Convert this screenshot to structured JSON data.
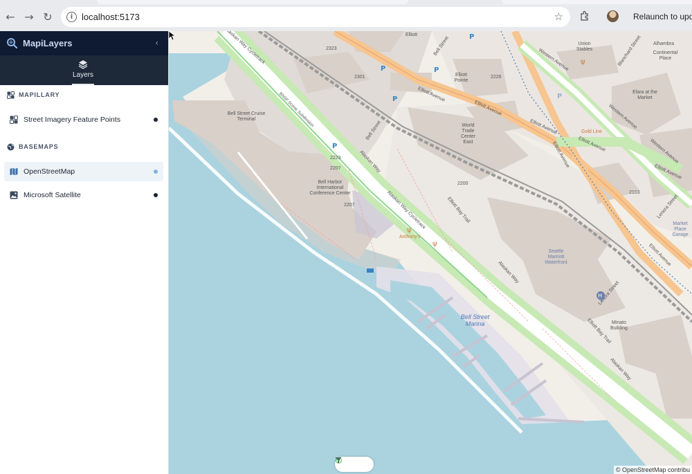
{
  "browser": {
    "url": "localhost:5173",
    "relaunch_label": "Relaunch to update"
  },
  "sidebar": {
    "app_name": "MapiLayers",
    "tabs": [
      {
        "label": "Layers",
        "icon": "layers-icon",
        "active": true
      }
    ],
    "sections": [
      {
        "title": "MAPILLARY",
        "icon": "mapillary-icon",
        "layers": [
          {
            "label": "Street Imagery Feature Points",
            "icon": "feature-points-icon",
            "active": false
          }
        ]
      },
      {
        "title": "BASEMAPS",
        "icon": "globe-icon",
        "layers": [
          {
            "label": "OpenStreetMap",
            "icon": "map-icon",
            "active": true
          },
          {
            "label": "Microsoft Satellite",
            "icon": "satellite-image-icon",
            "active": false
          }
        ]
      }
    ]
  },
  "map": {
    "attribution": "© OpenStreetMap contribu",
    "labels": {
      "alaskan_way_cycletrack": "Alaskan Way Cycletrack",
      "alaskan_way": "Alaskan Way",
      "elliott_bay_trail": "Elliott Bay Trail",
      "elliott_avenue": "Elliott Avenue",
      "western_avenue": "Western Avenue",
      "lenora_street": "Lenora Street",
      "blanchard_street": "Blanchard Street",
      "bell_street": "Bell Street",
      "bell_street_cruise_terminal": "Bell Street Cruise Terminal",
      "bell_harbor_center": "Bell Harbor International Conference Center",
      "world_trade_center_east": "World Trade Center East",
      "elliott_pointe": "Elliott Pointe",
      "union_stables": "Union Stables",
      "alhambra": "Alhambra",
      "continental_place": "Continental Place",
      "elara_at_the_market": "Elara at the Market",
      "market_place_garage": "Market Place Garage",
      "seattle_marriott_waterfront": "Seattle Marriott Waterfront",
      "bell_street_marina": "Bell Street Marina",
      "minato_building": "Minato Building",
      "anthonys": "Anthony's",
      "gold_line": "Gold Line",
      "elliott_street": "Elliott",
      "bnsf_scenic_subdivision": "BNSF Scenic Subdivision",
      "house_2323": "2323",
      "house_2301": "2301",
      "house_2226": "2226",
      "house_2200": "2200",
      "house_2223": "2223",
      "house_2207": "2207",
      "house_2207b": "2207",
      "house_2103": "2103"
    }
  }
}
